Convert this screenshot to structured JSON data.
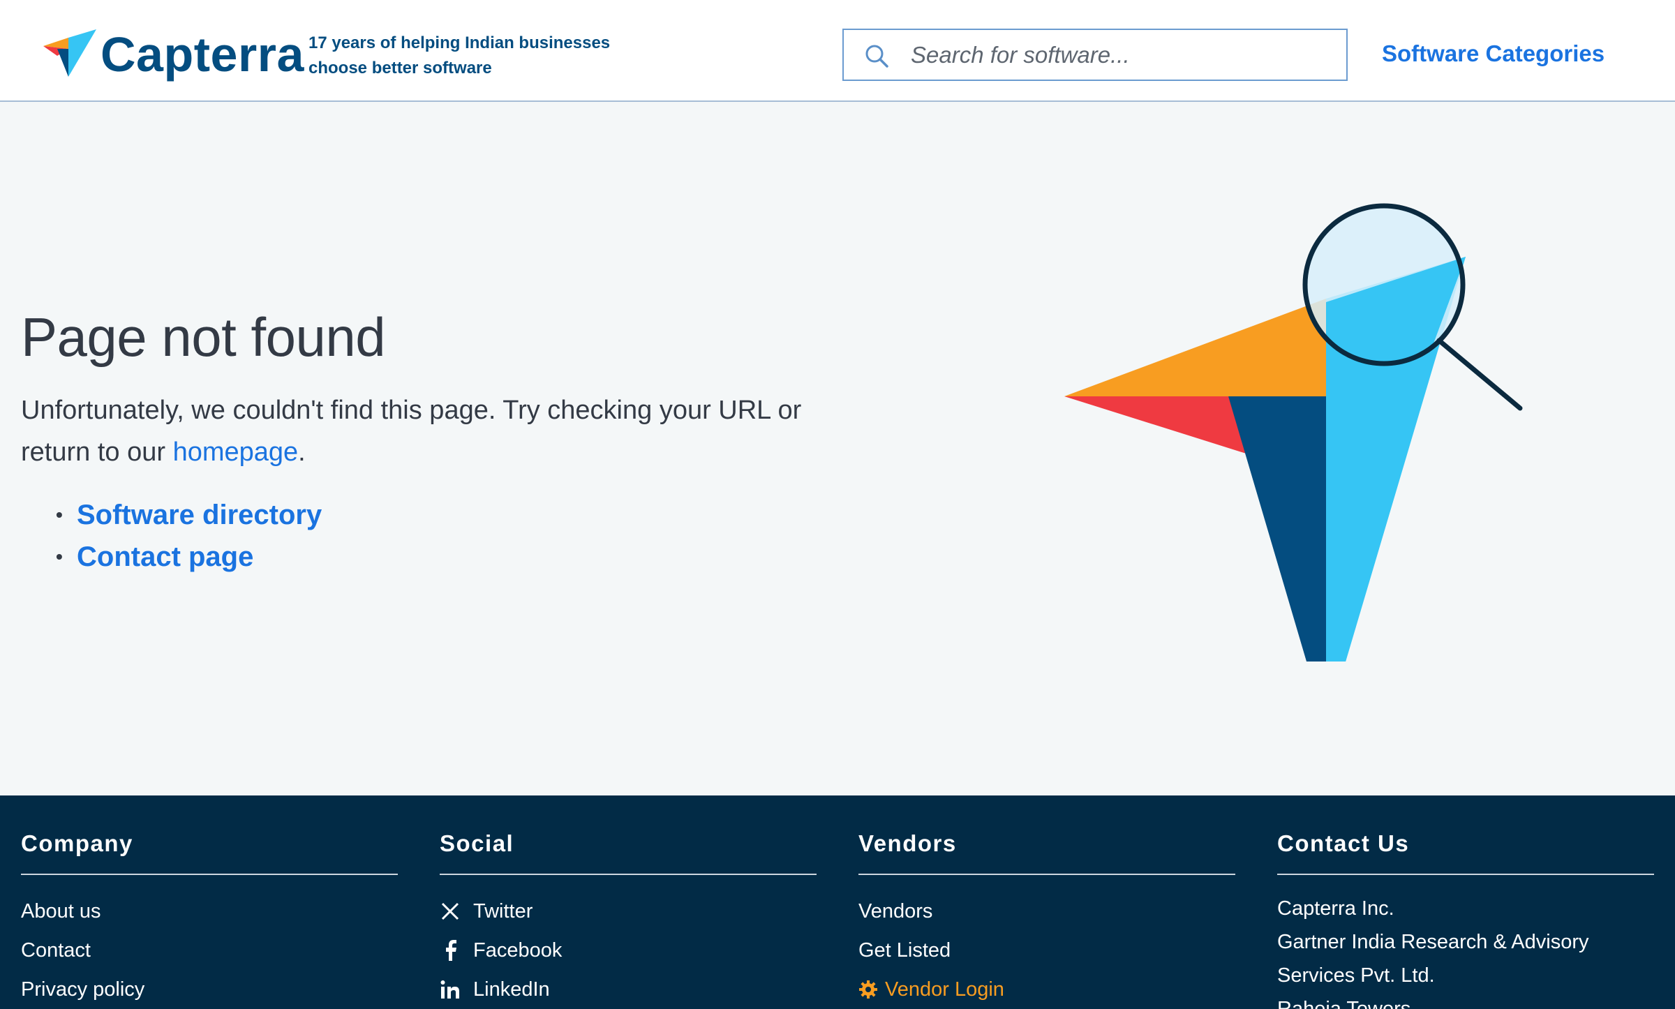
{
  "header": {
    "brand": "Capterra",
    "tagline_line1": "17 years of helping Indian businesses",
    "tagline_line2": "choose better software",
    "search_placeholder": "Search for software...",
    "categories_link": "Software Categories"
  },
  "main": {
    "title": "Page not found",
    "message_before": "Unfortunately, we couldn't find this page. Try checking your URL or return to our ",
    "homepage_link": "homepage",
    "message_after": ".",
    "links": [
      "Software directory",
      "Contact page"
    ]
  },
  "footer": {
    "company": {
      "heading": "Company",
      "items": [
        "About us",
        "Contact",
        "Privacy policy"
      ]
    },
    "social": {
      "heading": "Social",
      "items": [
        "Twitter",
        "Facebook",
        "LinkedIn"
      ]
    },
    "vendors": {
      "heading": "Vendors",
      "items": [
        "Vendors",
        "Get Listed"
      ],
      "vendor_login": "Vendor Login"
    },
    "contact": {
      "heading": "Contact Us",
      "lines": [
        "Capterra Inc.",
        "Gartner India Research & Advisory",
        "Services Pvt. Ltd.",
        "Raheja Towers"
      ]
    }
  },
  "colors": {
    "brand_navy": "#044d80",
    "link_blue": "#1a73e0",
    "footer_bg": "#022b46",
    "accent_orange": "#f89d21",
    "logo_red": "#ef3a41",
    "logo_light_blue": "#36c5f4"
  },
  "icons": [
    "capterra-logo",
    "search-icon",
    "x-twitter-icon",
    "facebook-icon",
    "linkedin-icon",
    "gear-icon",
    "magnifier-illustration"
  ]
}
